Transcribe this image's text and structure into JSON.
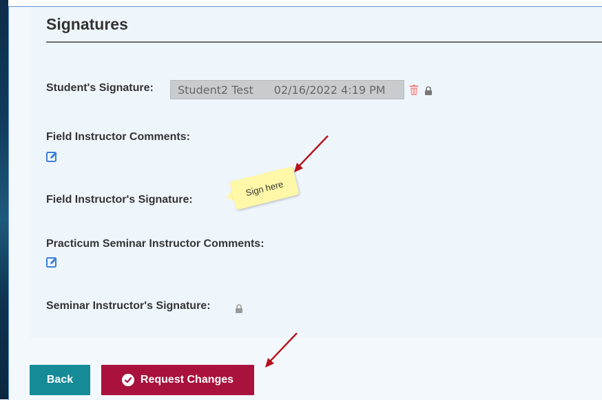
{
  "section": {
    "title": "Signatures"
  },
  "student": {
    "label": "Student's Signature:",
    "name": "Student2 Test",
    "timestamp": "02/16/2022 4:19 PM"
  },
  "field_instructor_comments": {
    "label": "Field Instructor Comments:"
  },
  "field_instructor_signature": {
    "label": "Field Instructor's Signature:"
  },
  "sticky_note": {
    "text": "Sign here"
  },
  "practicum_comments": {
    "label": "Practicum Seminar Instructor Comments:"
  },
  "seminar_signature": {
    "label": "Seminar Instructor's Signature:"
  },
  "buttons": {
    "back": "Back",
    "request_changes": "Request Changes"
  },
  "colors": {
    "back_button": "#148b96",
    "request_button": "#a8123c",
    "arrow": "#b5121b",
    "sticky": "#fff8a8"
  },
  "icons": {
    "trash": "trash-icon",
    "lock": "lock-icon",
    "edit": "edit-icon",
    "request": "circle-check-icon"
  }
}
